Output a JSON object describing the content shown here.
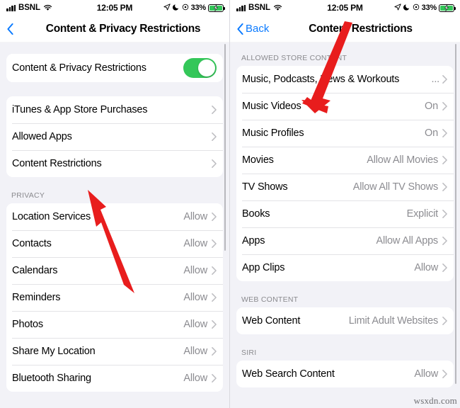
{
  "status_bar": {
    "carrier": "BSNL",
    "time": "12:05 PM",
    "battery_percent": "33%",
    "icons": [
      "signal-bars-icon",
      "wifi-icon",
      "location-arrow-icon",
      "moon-icon",
      "circle-icon",
      "battery-charging-icon"
    ]
  },
  "colors": {
    "accent_blue": "#0a7aff",
    "toggle_green": "#34c759",
    "arrow_red": "#e81d1d",
    "page_background": "#f2f2f7",
    "card_background": "#ffffff",
    "secondary_text": "#8c8c91"
  },
  "left_screen": {
    "nav": {
      "back_label": "",
      "title": "Content & Privacy Restrictions",
      "back_icon": "chevron-left-icon"
    },
    "toggle_row": {
      "label": "Content & Privacy Restrictions",
      "state": "on"
    },
    "restrictions": [
      {
        "label": "iTunes & App Store Purchases",
        "value": ""
      },
      {
        "label": "Allowed Apps",
        "value": ""
      },
      {
        "label": "Content Restrictions",
        "value": ""
      }
    ],
    "privacy_header": "PRIVACY",
    "privacy": [
      {
        "label": "Location Services",
        "value": "Allow"
      },
      {
        "label": "Contacts",
        "value": "Allow"
      },
      {
        "label": "Calendars",
        "value": "Allow"
      },
      {
        "label": "Reminders",
        "value": "Allow"
      },
      {
        "label": "Photos",
        "value": "Allow"
      },
      {
        "label": "Share My Location",
        "value": "Allow"
      },
      {
        "label": "Bluetooth Sharing",
        "value": "Allow"
      }
    ]
  },
  "right_screen": {
    "nav": {
      "back_label": "Back",
      "title": "Content Restrictions",
      "back_icon": "chevron-left-icon"
    },
    "allowed_store_header": "ALLOWED STORE CONTENT",
    "allowed_store": [
      {
        "label": "Music, Podcasts, News & Workouts",
        "value": "..."
      },
      {
        "label": "Music Videos",
        "value": "On"
      },
      {
        "label": "Music Profiles",
        "value": "On"
      },
      {
        "label": "Movies",
        "value": "Allow All Movies"
      },
      {
        "label": "TV Shows",
        "value": "Allow All TV Shows"
      },
      {
        "label": "Books",
        "value": "Explicit"
      },
      {
        "label": "Apps",
        "value": "Allow All Apps"
      },
      {
        "label": "App Clips",
        "value": "Allow"
      }
    ],
    "web_content_header": "WEB CONTENT",
    "web_content": [
      {
        "label": "Web Content",
        "value": "Limit Adult Websites"
      }
    ],
    "siri_header": "SIRI",
    "siri": [
      {
        "label": "Web Search Content",
        "value": "Allow"
      }
    ]
  },
  "annotations": {
    "left_arrow_target": "Content Restrictions",
    "right_arrow_target": "Web Content"
  },
  "watermark": "wsxdn.com"
}
